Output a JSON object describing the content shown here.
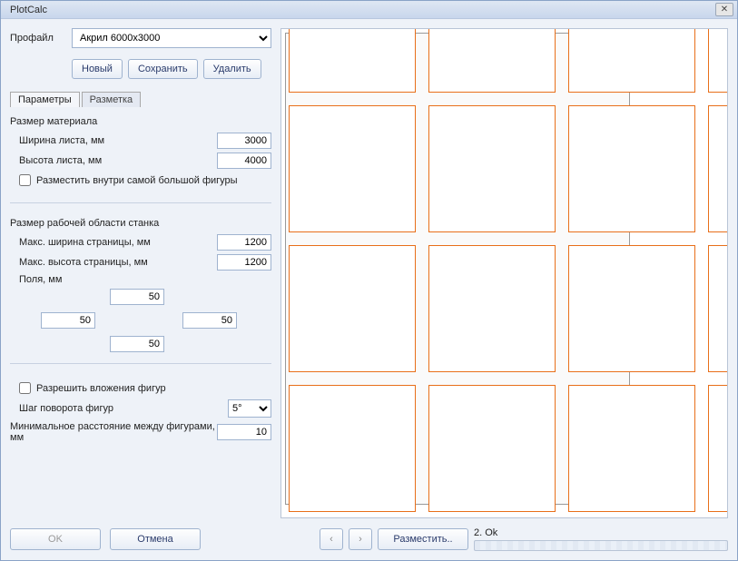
{
  "window": {
    "title": "PlotCalc"
  },
  "profile": {
    "label": "Профайл",
    "selected": "Акрил 6000х3000",
    "new_btn": "Новый",
    "save_btn": "Сохранить",
    "delete_btn": "Удалить"
  },
  "tabs": {
    "params": "Параметры",
    "markup": "Разметка"
  },
  "material": {
    "title": "Размер материала",
    "width_label": "Ширина листа, мм",
    "height_label": "Высота листа, мм",
    "width": "3000",
    "height": "4000",
    "fit_inside_label": "Разместить внутри самой большой фигуры"
  },
  "work_area": {
    "title": "Размер рабочей области станка",
    "max_width_label": "Макс. ширина страницы, мм",
    "max_height_label": "Макс. высота страницы, мм",
    "max_width": "1200",
    "max_height": "1200",
    "margins_label": "Поля, мм",
    "margin_top": "50",
    "margin_left": "50",
    "margin_right": "50",
    "margin_bottom": "50"
  },
  "options": {
    "allow_nesting_label": "Разрешить вложения фигур",
    "rotation_step_label": "Шаг поворота фигур",
    "rotation_step": "5°",
    "min_distance_label": "Минимальное расстояние между фигурами, мм",
    "min_distance": "10"
  },
  "footer": {
    "ok": "OK",
    "cancel": "Отмена",
    "place": "Разместить..",
    "status_prefix": "2.",
    "status": "Ok"
  }
}
